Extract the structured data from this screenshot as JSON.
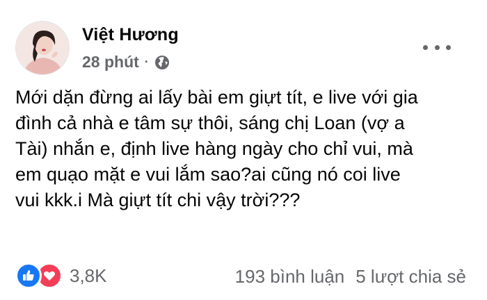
{
  "post": {
    "author": "Việt Hương",
    "time": "28 phút",
    "separator": "·",
    "privacy_icon": "globe-icon",
    "more_icon": "more-options-icon",
    "text": "Mới dặn đừng ai lấy bài em giựt tít, e live với gia\nđình cả nhà e tâm sự thôi, sáng chị Loan (vợ a\nTài) nhắn e, định live hàng ngày cho chỉ vui, mà\nem quạo mặt e vui lắm sao?ai cũng nó coi live\nvui kkk.i Mà giựt tít chi vậy trời???"
  },
  "footer": {
    "reaction_icons": [
      "like-icon",
      "love-icon"
    ],
    "reaction_count": "3,8K",
    "comments": "193 bình luận",
    "shares": "5 lượt chia sẻ"
  },
  "colors": {
    "secondary_text": "#65676b",
    "like_blue": "#1877f2",
    "love_red": "#f33e58"
  }
}
